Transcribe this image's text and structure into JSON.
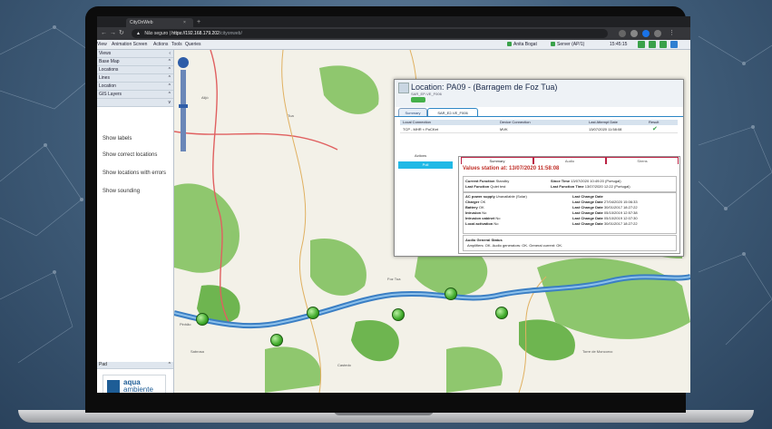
{
  "browser": {
    "tab_title": "CityOnWeb",
    "tab_close": "×",
    "new_tab": "+",
    "security_label": "Não seguro",
    "url_host": "https://192.168.179.202",
    "url_path": "/cityonweb/"
  },
  "menu": {
    "items": [
      "View",
      "Animation Screen",
      "Actions",
      "Tools",
      "Queries"
    ]
  },
  "status": {
    "user": "Anita Bogat",
    "server": "Server (AP/1)",
    "time": "15:45:15",
    "help": "Help Feat"
  },
  "sidebar": {
    "rows": [
      {
        "label": "Views",
        "chevron": "‹"
      },
      {
        "label": "Base Map",
        "chevron": "^"
      },
      {
        "label": "Locations",
        "chevron": "^"
      },
      {
        "label": "Lines",
        "chevron": "^"
      },
      {
        "label": "Location",
        "chevron": "^"
      },
      {
        "label": "GIS Layers",
        "chevron": "^"
      },
      {
        "label": "",
        "chevron": "v"
      }
    ],
    "links": [
      "Show labels",
      "Show correct locations",
      "Show locations with errors",
      "Show sounding"
    ],
    "footer_label": "Pad",
    "logo_line1": "aqua",
    "logo_line2": "ambiente"
  },
  "map": {
    "places": [
      "Pinhão",
      "Tua",
      "Foz Tua",
      "Carrazeda",
      "Alijó",
      "Sabrosa",
      "Torre de Moncorvo",
      "Castedo"
    ]
  },
  "popup": {
    "title": "Location: PA09 - (Barragem de Foz Tua)",
    "subtitle": "SAR_EP-VE_F006",
    "tabs": [
      "Summary",
      "SAR_E2-VE_F006"
    ],
    "grid_headers": [
      "Local Connection",
      "Device Connection",
      "Last Attempt Date",
      "Result"
    ],
    "grid_row": [
      "TCP - MHR < PoCKet",
      "MVK",
      "13/07/2020 11:58:08",
      "✔"
    ],
    "actions_label": "Actions",
    "action_button": "Poll",
    "detail_tabs": [
      "Summary",
      "Audio",
      "Sirens"
    ],
    "detail_heading": "Values station at: 13/07/2020 11:58:08",
    "current_function_label": "Current Function",
    "current_function": "Standby",
    "since_time_label": "Since Time",
    "since_time": "13/07/2020 10:49:20 (Portugal)",
    "last_function_label": "Last Function",
    "last_function": "Quiet test",
    "last_function_time_label": "Last Function Time",
    "last_function_time": "13/07/2020 12:22 (Portugal)",
    "status_rows": [
      {
        "label": "AC power supply",
        "value": "Unavailable (Solar)",
        "change_label": "Last Change Date",
        "change": ""
      },
      {
        "label": "Charger",
        "value": "OK",
        "change_label": "Last Change Date",
        "change": "27/04/2020 15:06:33"
      },
      {
        "label": "Battery",
        "value": "OK",
        "change_label": "Last Change Date",
        "change": "30/01/2017 18:27:22"
      },
      {
        "label": "Intrusion",
        "value": "No",
        "change_label": "Last Change Date",
        "change": "05/10/2019 12:57:38"
      },
      {
        "label": "Intrusion cabinet",
        "value": "No",
        "change_label": "Last Change Date",
        "change": "05/10/2019 12:07:30"
      },
      {
        "label": "Local activation",
        "value": "No",
        "change_label": "Last Change Date",
        "change": "30/01/2017 18:27:22"
      }
    ],
    "audio_label": "Audio General Status",
    "audio_status": "Amplifiers: OK. Audio generators: OK. General current: OK."
  },
  "colors": {
    "accent": "#21b9e6",
    "ok": "#3aa14a",
    "river": "#3b7fc4",
    "forest": "#5fae3f"
  }
}
